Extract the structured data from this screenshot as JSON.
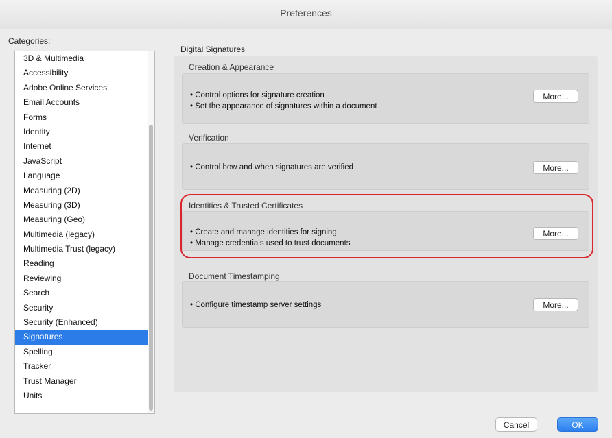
{
  "window": {
    "title": "Preferences"
  },
  "categories": {
    "label": "Categories:",
    "selected": "Signatures",
    "items": [
      "3D & Multimedia",
      "Accessibility",
      "Adobe Online Services",
      "Email Accounts",
      "Forms",
      "Identity",
      "Internet",
      "JavaScript",
      "Language",
      "Measuring (2D)",
      "Measuring (3D)",
      "Measuring (Geo)",
      "Multimedia (legacy)",
      "Multimedia Trust (legacy)",
      "Reading",
      "Reviewing",
      "Search",
      "Security",
      "Security (Enhanced)",
      "Signatures",
      "Spelling",
      "Tracker",
      "Trust Manager",
      "Units"
    ]
  },
  "main": {
    "section_title": "Digital Signatures",
    "groups": [
      {
        "label": "Creation & Appearance",
        "lines": [
          "• Control options for signature creation",
          "• Set the appearance of signatures within a document"
        ],
        "button": "More..."
      },
      {
        "label": "Verification",
        "lines": [
          "• Control how and when signatures are verified"
        ],
        "button": "More..."
      },
      {
        "label": "Identities & Trusted Certificates",
        "lines": [
          "• Create and manage identities for signing",
          "• Manage credentials used to trust documents"
        ],
        "button": "More..."
      },
      {
        "label": "Document Timestamping",
        "lines": [
          "• Configure timestamp server settings"
        ],
        "button": "More..."
      }
    ]
  },
  "footer": {
    "cancel_label": "Cancel",
    "ok_label": "OK"
  },
  "colors": {
    "selection": "#2b7ce9",
    "highlight_ring": "#d9262c",
    "ok_button": "#2d7ff0"
  }
}
